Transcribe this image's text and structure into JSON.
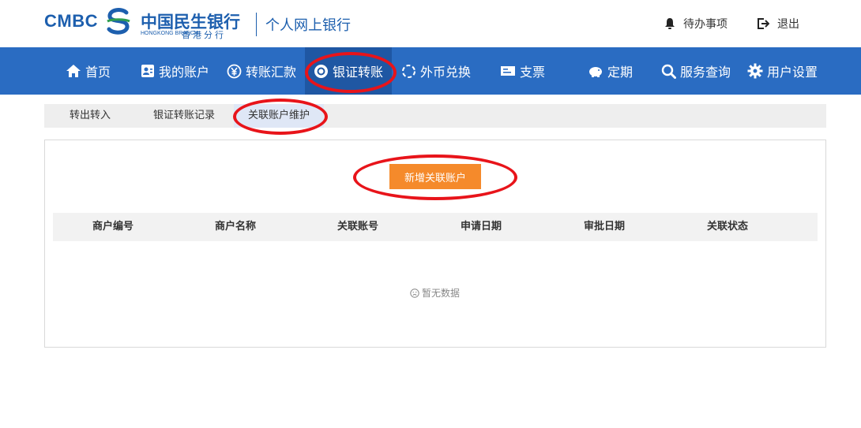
{
  "header": {
    "logo_cmbc": "CMBC",
    "logo_cn": "中国民生银行",
    "logo_sub_en": "HONGKONG BRANCH",
    "logo_sub_cn": "香港分行",
    "title": "个人网上银行",
    "todo_label": "待办事项",
    "logout_label": "退出",
    "brand_color": "#1d5fae"
  },
  "nav": {
    "items": [
      {
        "label": "首页",
        "icon": "home-icon"
      },
      {
        "label": "我的账户",
        "icon": "account-card-icon"
      },
      {
        "label": "转账汇款",
        "icon": "yen-transfer-icon"
      },
      {
        "label": "银证转账",
        "icon": "securities-icon",
        "active": true
      },
      {
        "label": "外币兑换",
        "icon": "exchange-icon"
      },
      {
        "label": "支票",
        "icon": "cheque-icon"
      },
      {
        "label": "定期",
        "icon": "piggy-bank-icon"
      },
      {
        "label": "服务查询",
        "icon": "search-icon"
      },
      {
        "label": "用户设置",
        "icon": "gear-icon"
      }
    ],
    "bg_color": "#2a6cc2"
  },
  "subtabs": {
    "items": [
      {
        "label": "转出转入"
      },
      {
        "label": "银证转账记录"
      },
      {
        "label": "关联账户维护",
        "active": true
      }
    ]
  },
  "main": {
    "add_button_label": "新增关联账户",
    "add_button_color": "#f58a2b",
    "table": {
      "columns": [
        "商户编号",
        "商户名称",
        "关联账号",
        "申请日期",
        "审批日期",
        "关联状态"
      ],
      "rows": []
    },
    "empty_text": "暂无数据"
  },
  "annotation_color": "#e8141a"
}
